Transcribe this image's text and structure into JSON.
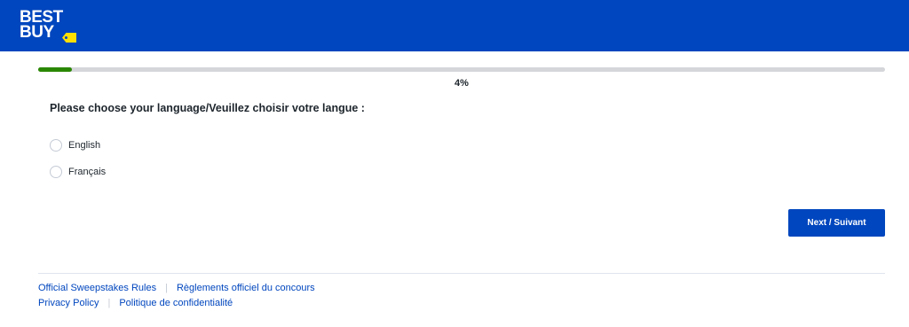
{
  "header": {
    "logo_line1": "BEST",
    "logo_line2": "BUY",
    "brand_color": "#0046be",
    "tag_color": "#ffe000"
  },
  "progress": {
    "value_percent": 4,
    "label": "4%",
    "fill_color": "#2a8703"
  },
  "question": {
    "text": "Please choose your language/Veuillez choisir votre langue :",
    "options": [
      {
        "label": "English",
        "selected": false
      },
      {
        "label": "Français",
        "selected": false
      }
    ]
  },
  "actions": {
    "next_label": "Next / Suivant"
  },
  "footer": {
    "row1": [
      "Official Sweepstakes Rules",
      "Règlements officiel du concours"
    ],
    "row2": [
      "Privacy Policy",
      "Politique de confidentialité"
    ],
    "separator": "|"
  }
}
